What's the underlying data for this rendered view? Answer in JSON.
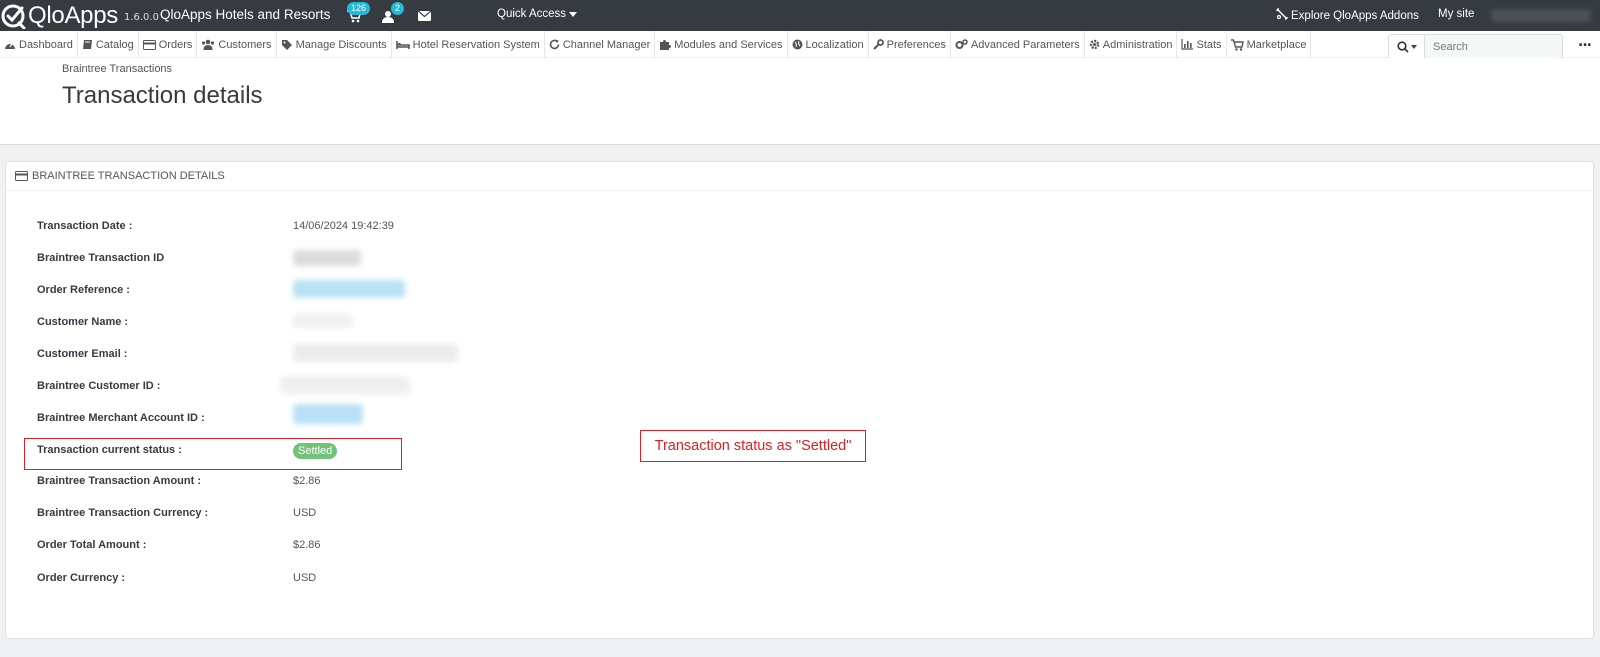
{
  "header": {
    "logo_text": "QloApps",
    "version": "1.6.0.0",
    "shop_name": "QloApps Hotels and Resorts",
    "orders_badge": "126",
    "customers_badge": "2",
    "quick_access": "Quick Access",
    "explore_addons": "Explore QloApps Addons",
    "my_site": "My site"
  },
  "nav": {
    "items": [
      {
        "label": "Dashboard",
        "icon": "dashboard-icon"
      },
      {
        "label": "Catalog",
        "icon": "book-icon"
      },
      {
        "label": "Orders",
        "icon": "credit-card-icon"
      },
      {
        "label": "Customers",
        "icon": "users-icon"
      },
      {
        "label": "Manage Discounts",
        "icon": "tag-icon"
      },
      {
        "label": "Hotel Reservation System",
        "icon": "bed-icon"
      },
      {
        "label": "Channel Manager",
        "icon": "refresh-icon"
      },
      {
        "label": "Modules and Services",
        "icon": "puzzle-icon"
      },
      {
        "label": "Localization",
        "icon": "globe-icon"
      },
      {
        "label": "Preferences",
        "icon": "wrench-icon"
      },
      {
        "label": "Advanced Parameters",
        "icon": "cogs-icon"
      },
      {
        "label": "Administration",
        "icon": "cog-icon"
      },
      {
        "label": "Stats",
        "icon": "bar-chart-icon"
      },
      {
        "label": "Marketplace",
        "icon": "cart-icon"
      }
    ],
    "search_placeholder": "Search",
    "more": "..."
  },
  "page": {
    "breadcrumb": "Braintree Transactions",
    "title": "Transaction details"
  },
  "panel": {
    "heading": "BRAINTREE TRANSACTION DETAILS",
    "rows": [
      {
        "label": "Transaction Date :",
        "value": "14/06/2024 19:42:39"
      },
      {
        "label": "Braintree Transaction ID",
        "value": ""
      },
      {
        "label": "Order Reference :",
        "value": ""
      },
      {
        "label": "Customer Name :",
        "value": ""
      },
      {
        "label": "Customer Email :",
        "value": ""
      },
      {
        "label": "Braintree Customer ID :",
        "value": ""
      },
      {
        "label": "Braintree Merchant Account ID :",
        "value": ""
      },
      {
        "label": "Transaction current status :",
        "value": "Settled"
      },
      {
        "label": "Braintree Transaction Amount :",
        "value": "$2.86"
      },
      {
        "label": "Braintree Transaction Currency :",
        "value": "USD"
      },
      {
        "label": "Order Total Amount :",
        "value": "$2.86"
      },
      {
        "label": "Order Currency :",
        "value": "USD"
      }
    ]
  },
  "annotation": {
    "text": "Transaction status as \"Settled\"",
    "color": "#e02020"
  },
  "colors": {
    "header_bg": "#363a41",
    "badge": "#25b9d7",
    "status_settled": "#72c279"
  }
}
